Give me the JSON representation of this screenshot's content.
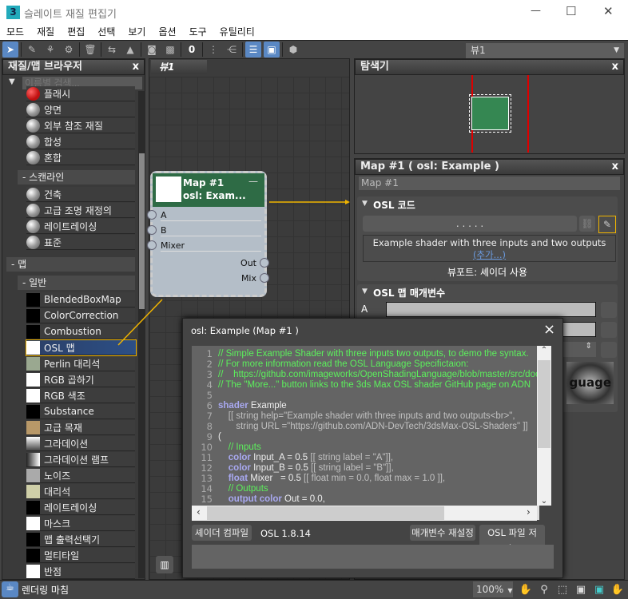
{
  "window": {
    "title": "슬레이트 재질 편집기",
    "app_icon": "3",
    "minimize": "—",
    "maximize": "☐",
    "close": "✕"
  },
  "menu": [
    "모드",
    "재질",
    "편집",
    "선택",
    "보기",
    "옵션",
    "도구",
    "유틸리티"
  ],
  "toolbar": {
    "view_dropdown": "뷰1"
  },
  "browser": {
    "title": "재질/맵 브라우저",
    "close": "x",
    "search_placeholder": "이름별 검색...",
    "materials": [
      {
        "label": "플래시",
        "color": "#c01010"
      },
      {
        "label": "양면"
      },
      {
        "label": "외부 참조 재질"
      },
      {
        "label": "합성"
      },
      {
        "label": "혼합"
      }
    ],
    "scanline_group": "- 스캔라인",
    "scanline": [
      "건축",
      "고급 조명 재정의",
      "레이트레이싱",
      "표준"
    ],
    "maps_group": "- 맵",
    "general_group": "- 일반",
    "maps": [
      {
        "label": "BlendedBoxMap",
        "swatch": "#000"
      },
      {
        "label": "ColorCorrection",
        "swatch": "#000"
      },
      {
        "label": "Combustion",
        "swatch": "#000"
      },
      {
        "label": "OSL 맵",
        "swatch": "#fff",
        "selected": true
      },
      {
        "label": "Perlin 대리석",
        "swatch": "#9aa890"
      },
      {
        "label": "RGB 곱하기",
        "swatch": "#fff"
      },
      {
        "label": "RGB 색조",
        "swatch": "#fff"
      },
      {
        "label": "Substance",
        "swatch": "#000"
      },
      {
        "label": "고급 목재",
        "swatch": "#b89868"
      },
      {
        "label": "그라데이션",
        "swatch": "linear-gradient(#fff,#444)"
      },
      {
        "label": "그라데이션 램프",
        "swatch": "linear-gradient(90deg,#222,#fff)"
      },
      {
        "label": "노이즈",
        "swatch": "#aaa"
      },
      {
        "label": "대리석",
        "swatch": "#cfcfa8"
      },
      {
        "label": "레이트레이싱",
        "swatch": "#000"
      },
      {
        "label": "마스크",
        "swatch": "#fff"
      },
      {
        "label": "맵 출력선택기",
        "swatch": "#000"
      },
      {
        "label": "멀티타일",
        "swatch": "#000"
      },
      {
        "label": "반점",
        "swatch": "#fff"
      }
    ]
  },
  "view": {
    "tab": "뷰1",
    "node": {
      "title": "Map #1",
      "subtitle": "osl: Exam...",
      "inputs": [
        "A",
        "B",
        "Mixer"
      ],
      "outputs": [
        "Out",
        "Mix"
      ]
    }
  },
  "navigator": {
    "title": "탐색기",
    "close": "x"
  },
  "params": {
    "title": "Map #1  ( osl: Example )",
    "close": "x",
    "name_field": "Map #1",
    "osl_code_section": "OSL 코드",
    "file_field": ". . . . .",
    "description": "Example shader with three inputs and two outputs",
    "more_link": "(추가...)",
    "viewport_note": "뷰포트: 셰이더 사용",
    "map_params_section": "OSL 맵 매개변수",
    "param_a": "A",
    "preview_text": "guage"
  },
  "editor": {
    "title": "osl: Example (Map #1 )",
    "close": "×",
    "lines": [
      [
        [
          "c-comment",
          "// Simple Example Shader with three inputs two outputs, to demo the syntax."
        ]
      ],
      [
        [
          "c-comment",
          "// For more information read the OSL Language Specifictaion:"
        ]
      ],
      [
        [
          "c-comment",
          "//    https://github.com/imageworks/OpenShadingLanguage/blob/master/src/doc/os"
        ]
      ],
      [
        [
          "c-comment",
          "// The \"More...\" button links to the 3ds Max OSL shader GitHub page on ADN"
        ]
      ],
      [
        [
          "",
          ""
        ]
      ],
      [
        [
          "c-kw",
          "shader"
        ],
        [
          "",
          " Example"
        ]
      ],
      [
        [
          "c-meta",
          "    [[ string help=\"Example shader with three inputs and two outputs<br>\","
        ]
      ],
      [
        [
          "c-meta",
          "       string URL =\"https://github.com/ADN-DevTech/3dsMax-OSL-Shaders\" ]]"
        ]
      ],
      [
        [
          "",
          "("
        ]
      ],
      [
        [
          "c-comment",
          "    // Inputs"
        ]
      ],
      [
        [
          "c-kw",
          "    color"
        ],
        [
          "",
          " Input_A = 0.5 "
        ],
        [
          "c-meta",
          "[[ string label = \"A\"]],"
        ]
      ],
      [
        [
          "c-kw",
          "    color"
        ],
        [
          "",
          " Input_B = 0.5 "
        ],
        [
          "c-meta",
          "[[ string label = \"B\"]],"
        ]
      ],
      [
        [
          "c-kw",
          "    float"
        ],
        [
          "",
          " Mixer   = 0.5 "
        ],
        [
          "c-meta",
          "[[ float min = 0.0, float max = 1.0 ]],"
        ]
      ],
      [
        [
          "c-comment",
          "    // Outputs"
        ]
      ],
      [
        [
          "c-kw",
          "    output color"
        ],
        [
          "",
          " Out = 0.0,"
        ]
      ]
    ],
    "compile": "셰이더 컴파일",
    "version": "OSL 1.8.14",
    "reset": "매개변수 재설정",
    "save": "OSL 파일 저장..."
  },
  "status": {
    "text": "렌더링 마침",
    "zoom": "100%"
  },
  "colors": {
    "accent": "#5a88c4",
    "node_header": "#2e6b45",
    "link": "#f0b400",
    "selection": "#2c4f86"
  }
}
